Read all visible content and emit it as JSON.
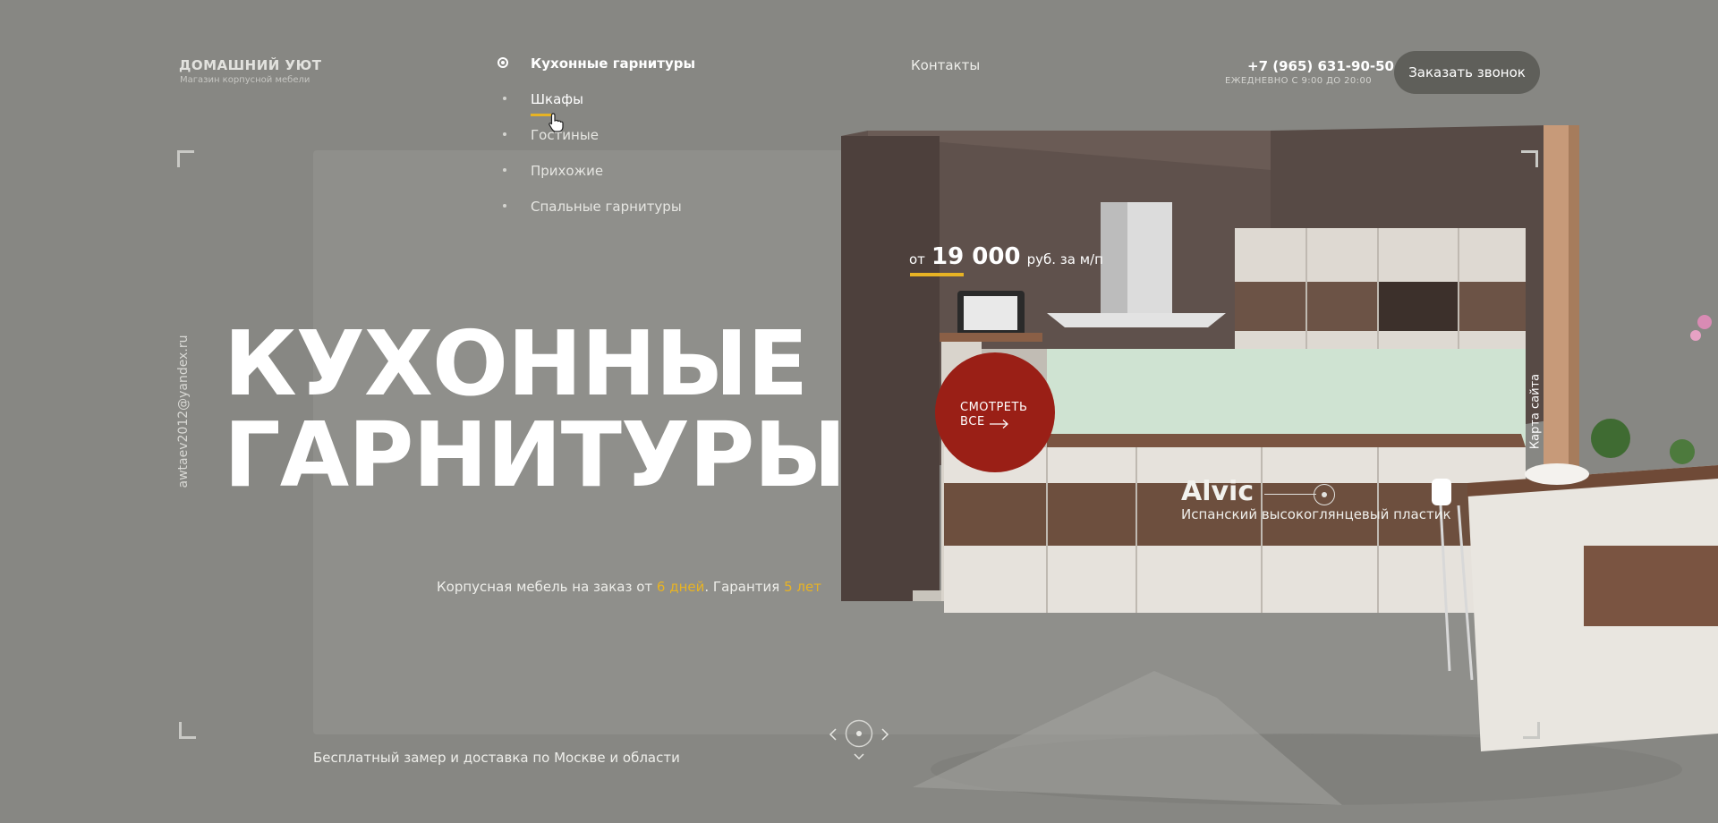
{
  "logo": {
    "title": "ДОМАШНИЙ УЮТ",
    "subtitle": "Магазин корпусной мебели"
  },
  "nav": {
    "items": [
      {
        "label": "Кухонные гарнитуры",
        "state": "current"
      },
      {
        "label": "Шкафы",
        "state": "hover"
      },
      {
        "label": "Гостиные",
        "state": "normal"
      },
      {
        "label": "Прихожие",
        "state": "normal"
      },
      {
        "label": "Спальные гарнитуры",
        "state": "normal"
      }
    ],
    "contacts_label": "Контакты"
  },
  "header": {
    "phone": "+7 (965) 631-90-50",
    "hours": "ЕЖЕДНЕВНО С 9:00 ДО 20:00",
    "callback_button": "Заказать звонок"
  },
  "side": {
    "email": "awtaev2012@yandex.ru",
    "sitemap": "Карта сайта"
  },
  "hero": {
    "headline_line1": "КУХОННЫЕ",
    "headline_line2": "ГАРНИТУРЫ",
    "price_prefix": "от",
    "price_value": "19 000",
    "price_unit": "руб. за м/п",
    "cta_line1": "СМОТРЕТЬ",
    "cta_line2": "ВСЕ",
    "material_name": "Alvic",
    "material_desc": "Испанский высокоглянцевый пластик",
    "tagline_start": "Корпусная мебель на заказ от",
    "tagline_days": "6 дней",
    "tagline_mid": ". Гарантия",
    "tagline_years": "5 лет",
    "delivery": "Бесплатный замер и доставка по Москве и области"
  },
  "icons": {
    "cursor": "hand-pointer-icon",
    "cta_arrow": "arrow-right-icon",
    "slider_prev": "chevron-left-icon",
    "slider_next": "chevron-right-icon",
    "slider_center": "circle-dot-icon",
    "scroll_down": "chevron-down-icon"
  },
  "colors": {
    "background": "#878783",
    "accent_yellow": "#e7b324",
    "cta_red": "#9a1f16",
    "button_dark": "#5f5f5a"
  }
}
